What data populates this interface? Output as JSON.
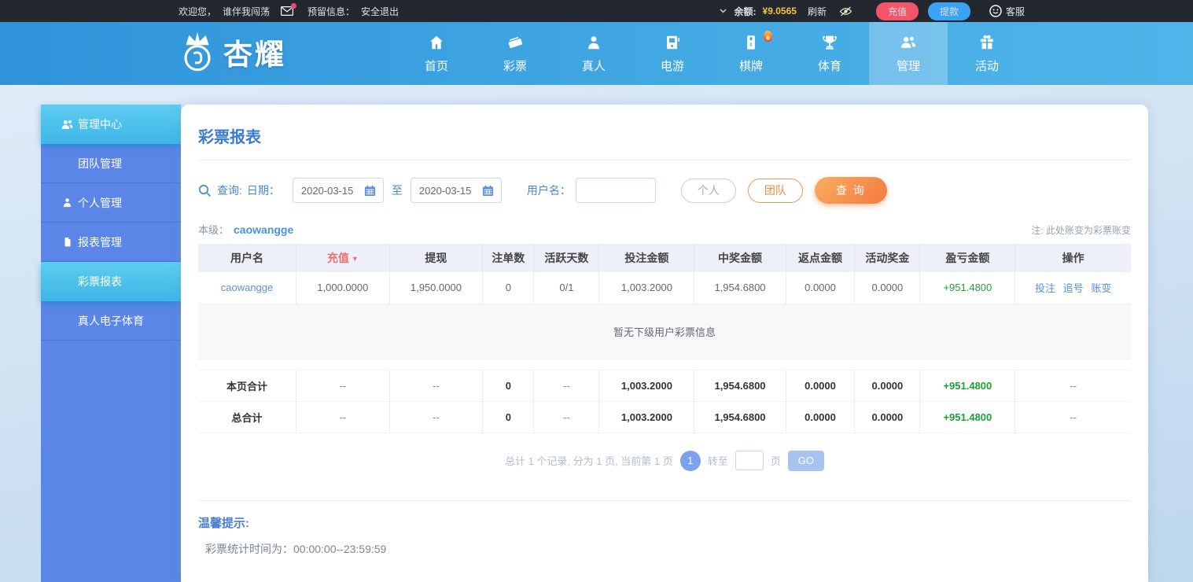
{
  "icons": {
    "sort_desc": "▼"
  },
  "colors": {
    "accent_blue": "#3a7ad0",
    "sidebar_blue": "#5b86e8",
    "sidebar_active_cyan": "#4cc4ec",
    "nav_blue": "#42a8e3",
    "deposit_red": "#f25568",
    "withdraw_blue": "#3aa3f3",
    "balance_yellow": "#f5c242",
    "profit_green": "#21a03a",
    "sort_red": "#f56c6c"
  },
  "topbar": {
    "welcome_label": "欢迎您，",
    "username": "谁伴我闯荡",
    "message_label": "预留信息：",
    "logout_label": "安全退出",
    "balance_label": "余额:",
    "balance_value": "¥9.0565",
    "refresh_label": "刷新",
    "deposit_button": "充值",
    "withdraw_button": "提款",
    "service_label": "客服"
  },
  "navbar": {
    "logo_text": "杏耀",
    "items": [
      {
        "label": "首页",
        "icon": "home-icon"
      },
      {
        "label": "彩票",
        "icon": "ticket-icon"
      },
      {
        "label": "真人",
        "icon": "person-icon"
      },
      {
        "label": "电游",
        "icon": "slot-machine-icon"
      },
      {
        "label": "棋牌",
        "icon": "mahjong-icon",
        "badge": "flame"
      },
      {
        "label": "体育",
        "icon": "trophy-icon"
      },
      {
        "label": "管理",
        "icon": "users-icon",
        "active": true
      },
      {
        "label": "活动",
        "icon": "gift-icon"
      }
    ]
  },
  "sidebar": {
    "items": [
      {
        "label": "管理中心",
        "icon": "users-icon",
        "active": true
      },
      {
        "label": "团队管理"
      },
      {
        "label": "个人管理",
        "icon": "user-icon"
      },
      {
        "label": "报表管理",
        "icon": "document-icon"
      },
      {
        "label": "彩票报表",
        "active": true
      },
      {
        "label": "真人电子体育"
      }
    ]
  },
  "main": {
    "page_title": "彩票报表",
    "search": {
      "query_label": "查询:",
      "date_label": "日期：",
      "date_from": "2020-03-15",
      "to_label": "至",
      "date_to": "2020-03-15",
      "username_label": "用户名：",
      "username_value": "",
      "personal_button": "个人",
      "team_button": "团队",
      "search_button": "查 询"
    },
    "level_label": "本级：",
    "level_username": "caowangge",
    "note": "注: 此处账变为彩票账变",
    "table": {
      "headers": [
        "用户名",
        "充值",
        "提现",
        "注单数",
        "活跃天数",
        "投注金额",
        "中奖金额",
        "返点金额",
        "活动奖金",
        "盈亏金额",
        "操作"
      ],
      "sorted_by": "充值",
      "row": {
        "username": "caowangge",
        "deposit": "1,000.0000",
        "withdraw": "1,950.0000",
        "bet_count": "0",
        "active_days": "0/1",
        "bet_amount": "1,003.2000",
        "win_amount": "1,954.6800",
        "rebate_amount": "0.0000",
        "activity_bonus": "0.0000",
        "profit_loss": "+951.4800",
        "actions": [
          "投注",
          "追号",
          "账变"
        ]
      },
      "empty_text": "暂无下级用户彩票信息",
      "page_total": {
        "label": "本页合计",
        "values": [
          "--",
          "--",
          "0",
          "--",
          "1,003.2000",
          "1,954.6800",
          "0.0000",
          "0.0000",
          "+951.4800",
          "--"
        ]
      },
      "grand_total": {
        "label": "总合计",
        "values": [
          "--",
          "--",
          "0",
          "--",
          "1,003.2000",
          "1,954.6800",
          "0.0000",
          "0.0000",
          "+951.4800",
          "--"
        ]
      }
    },
    "pagination": {
      "summary": "总计 1 个记录, 分为 1 页, 当前第 1 页",
      "current_page": "1",
      "goto_label": "转至",
      "page_unit": "页",
      "go_button": "GO"
    },
    "tips": {
      "title": "温馨提示:",
      "content": "彩票统计时间为：00:00:00--23:59:59"
    }
  }
}
